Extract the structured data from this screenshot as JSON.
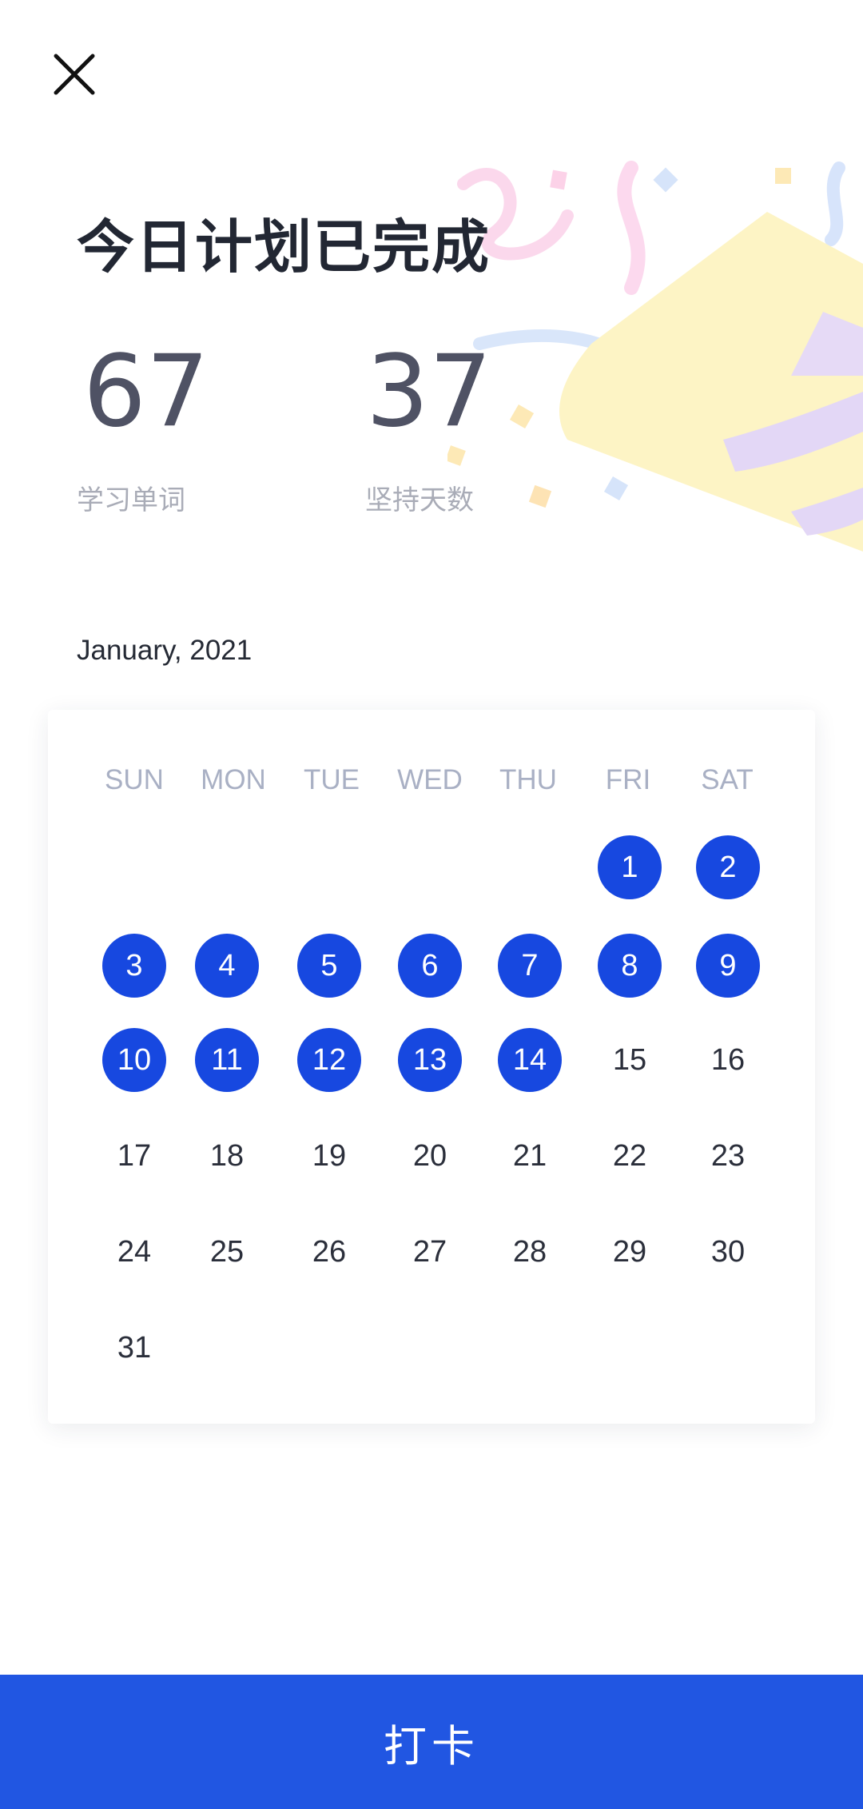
{
  "header": {
    "close_icon": "close-icon"
  },
  "title": "今日计划已完成",
  "stats": [
    {
      "value": "67",
      "label": "学习单词"
    },
    {
      "value": "37",
      "label": "坚持天数"
    }
  ],
  "calendar": {
    "month_label": "January, 2021",
    "weekdays": [
      "SUN",
      "MON",
      "TUE",
      "WED",
      "THU",
      "FRI",
      "SAT"
    ],
    "first_weekday_index": 5,
    "days_in_month": 31,
    "completed_days": [
      1,
      2,
      3,
      4,
      5,
      6,
      7,
      8,
      9,
      10,
      11,
      12,
      13,
      14
    ],
    "colors": {
      "completed": "#1748e0",
      "text": "#2b2f3b",
      "weekday": "#a9b0c4"
    }
  },
  "checkin_button": {
    "label": "打卡",
    "color": "#2156e2"
  }
}
